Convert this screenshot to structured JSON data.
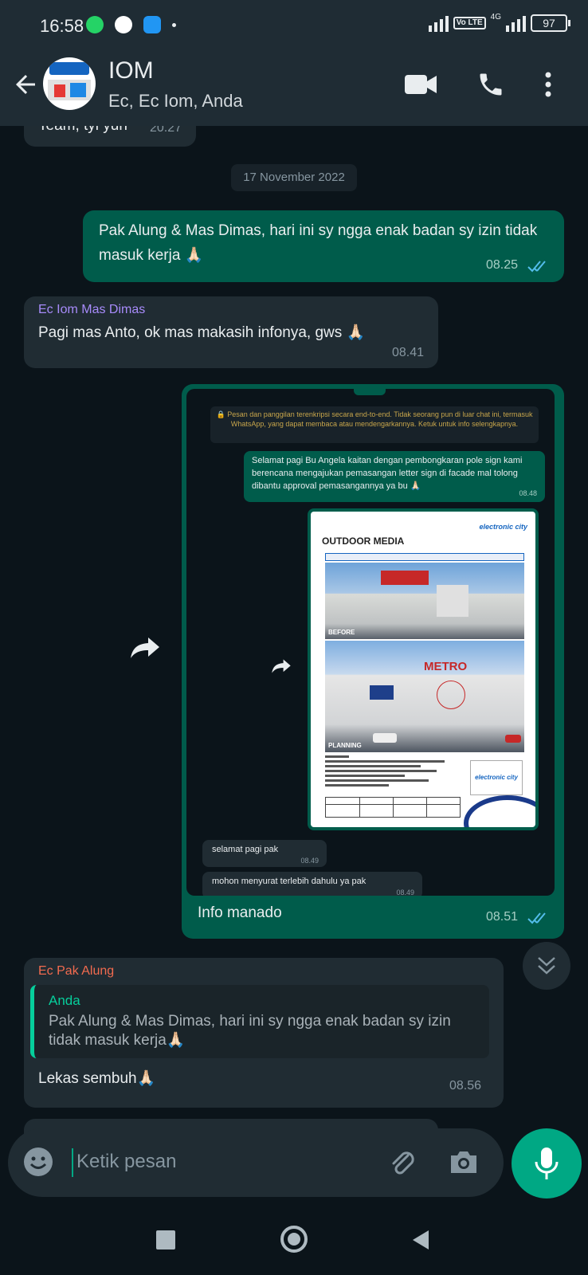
{
  "status": {
    "time": "16:58",
    "network": "4G",
    "volte": "Vo LTE",
    "battery": "97"
  },
  "header": {
    "title": "IOM",
    "subtitle": "Ec, Ec Iom, Anda"
  },
  "messages": {
    "partial_top": {
      "text": "Team, tyi yuh",
      "time": "20.27"
    },
    "date_chip": "17 November 2022",
    "m1": {
      "text": "Pak Alung & Mas Dimas, hari ini sy ngga enak badan sy izin tidak masuk kerja 🙏🏻",
      "time": "08.25"
    },
    "m2": {
      "sender": "Ec Iom Mas Dimas",
      "text": "Pagi mas Anto, ok mas makasih infonya, gws 🙏🏻",
      "time": "08.41"
    },
    "m3": {
      "caption": "Info manado",
      "time": "08.51",
      "screenshot": {
        "encryption_notice": "🔒 Pesan dan panggilan terenkripsi secara end-to-end. Tidak seorang pun di luar chat ini, termasuk WhatsApp, yang dapat membaca atau mendengarkannya. Ketuk untuk info selengkapnya.",
        "out_text": "Selamat pagi Bu Angela kaitan dengan pembongkaran pole sign kami berencana mengajukan pemasangan letter sign di facade mal tolong dibantu approval pemasangannya ya bu 🙏🏻",
        "out_time": "08.48",
        "doc_title": "OUTDOOR MEDIA",
        "doc_brand": "electronic city",
        "doc_caption_before": "BEFORE",
        "doc_caption_planning": "PLANNING",
        "doc_store_sign": "METRO",
        "image_time": "08.49",
        "in1_text": "selamat pagi pak",
        "in1_time": "08.49",
        "in2_text": "mohon menyurat terlebih dahulu ya pak",
        "in2_time": "08.49"
      }
    },
    "m4": {
      "sender": "Ec Pak Alung",
      "quote_name": "Anda",
      "quote_text": "Pak Alung & Mas Dimas, hari ini sy ngga enak badan sy izin tidak masuk kerja🙏🏻",
      "text": "Lekas sembuh🙏🏻",
      "time": "08.56"
    }
  },
  "composer": {
    "placeholder": "Ketik pesan"
  },
  "colors": {
    "outgoing": "#005c4b",
    "incoming": "#202c33",
    "accent": "#00a884",
    "sender_dimas": "#a78bfa",
    "sender_alung": "#f26b4f",
    "read_ticks": "#53bdeb"
  }
}
